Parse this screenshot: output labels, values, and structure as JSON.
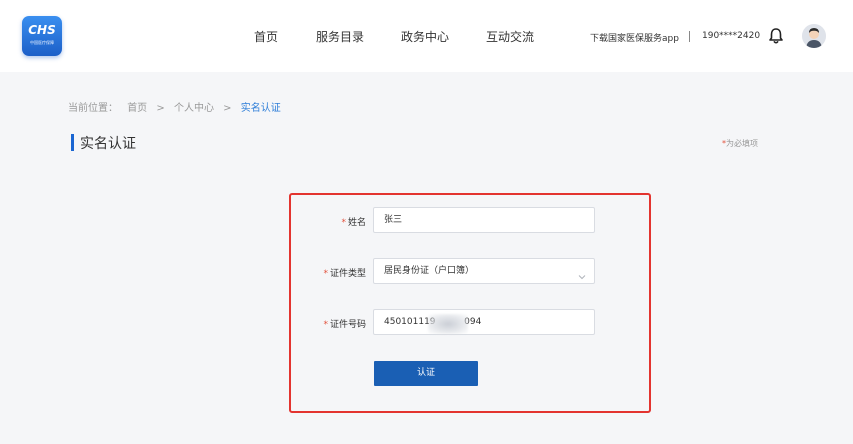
{
  "header": {
    "logo_text": "CHS",
    "logo_sub": "中国医疗保障",
    "nav": [
      {
        "label": "首页"
      },
      {
        "label": "服务目录"
      },
      {
        "label": "政务中心"
      },
      {
        "label": "互动交流"
      }
    ],
    "download_label": "下载国家医保服务app",
    "separator": "|",
    "phone": "190****2420"
  },
  "breadcrumb": {
    "prefix": "当前位置：",
    "items": [
      "首页",
      ">",
      "个人中心",
      ">",
      "实名认证"
    ]
  },
  "page": {
    "title": "实名认证",
    "required_star": "*",
    "required_note": "为必填项"
  },
  "form": {
    "name": {
      "label": "姓名",
      "value": "张三"
    },
    "id_type": {
      "label": "证件类型",
      "value": "居民身份证（户口簿）"
    },
    "id_number": {
      "label": "证件号码",
      "value": "450101119          094"
    },
    "submit_label": "认证",
    "star": "*"
  },
  "colors": {
    "brand": "#1a66d2",
    "button": "#1a5fb4",
    "highlight_border": "#e3342f",
    "required": "#e2513c",
    "active_crumb": "#2e7ed8"
  },
  "icons": [
    "bell-icon",
    "avatar",
    "chevron-down-icon"
  ]
}
